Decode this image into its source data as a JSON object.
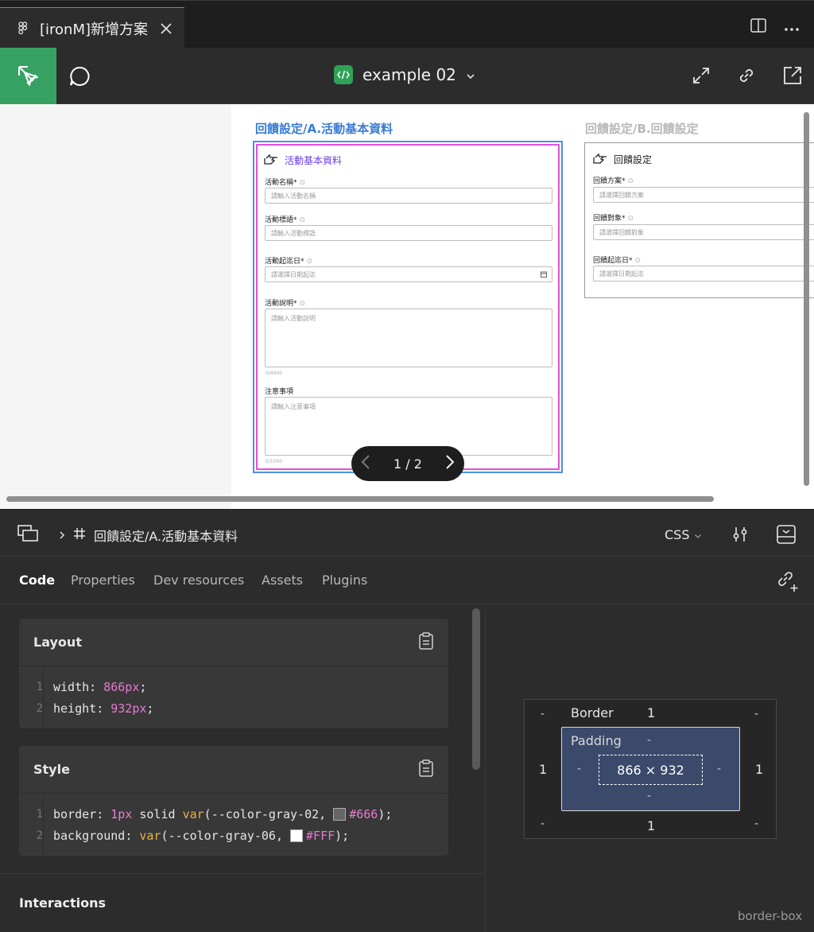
{
  "tab": {
    "title": "[ironM]新增方案"
  },
  "toolbar": {
    "file_name": "example 02"
  },
  "canvas": {
    "frame_a_title": "回饋設定/A.活動基本資料",
    "frame_b_title": "回饋設定/B.回饋設定",
    "section_a": {
      "heading": "活動基本資料",
      "fields": [
        {
          "label": "活動名稱*",
          "placeholder": "請輸入活動名稱"
        },
        {
          "label": "活動標語*",
          "placeholder": "請輸入活動標語"
        },
        {
          "label": "活動起迄日*",
          "placeholder": "請選擇日期起迄"
        },
        {
          "label": "活動說明*",
          "placeholder": "請輸入活動說明",
          "count": "0/4000"
        },
        {
          "label": "注意事項",
          "placeholder": "請輸入注意事項",
          "count": "0/1000"
        }
      ]
    },
    "section_b": {
      "heading": "回饋設定",
      "fields": [
        {
          "label": "回饋方案*",
          "placeholder": "請選擇回饋方案"
        },
        {
          "label": "回饋對象*",
          "placeholder": "請選擇回饋對象"
        },
        {
          "label": "回饋起迄日*",
          "placeholder": "請選擇日期起迄"
        }
      ]
    },
    "pager": "1 / 2"
  },
  "inspector": {
    "breadcrumb": "回饋設定/A.活動基本資料",
    "language": "CSS",
    "tabs": [
      "Code",
      "Properties",
      "Dev resources",
      "Assets",
      "Plugins"
    ],
    "layout": {
      "title": "Layout",
      "lines": [
        {
          "n": "1",
          "prop": "width",
          "value": "866px"
        },
        {
          "n": "2",
          "prop": "height",
          "value": "932px"
        }
      ]
    },
    "style": {
      "title": "Style",
      "line1": {
        "n": "1",
        "prop": "border",
        "num": "1px",
        "kw": "solid",
        "fn": "var",
        "arg": "--color-gray-02",
        "hex": "#666"
      },
      "line2": {
        "n": "2",
        "prop": "background",
        "fn": "var",
        "arg": "--color-gray-06",
        "hex": "#FFF"
      }
    },
    "interactions": "Interactions",
    "box_model": {
      "border_label": "Border",
      "border_value": "1",
      "padding_label": "Padding",
      "dash": "-",
      "left": "1",
      "right": "1",
      "bottom": "1",
      "size": "866 × 932",
      "box_sizing": "border-box"
    }
  },
  "colors": {
    "accent": "#36a162",
    "selection": "#4d8ef0",
    "frame_pink": "#e84fd4"
  }
}
